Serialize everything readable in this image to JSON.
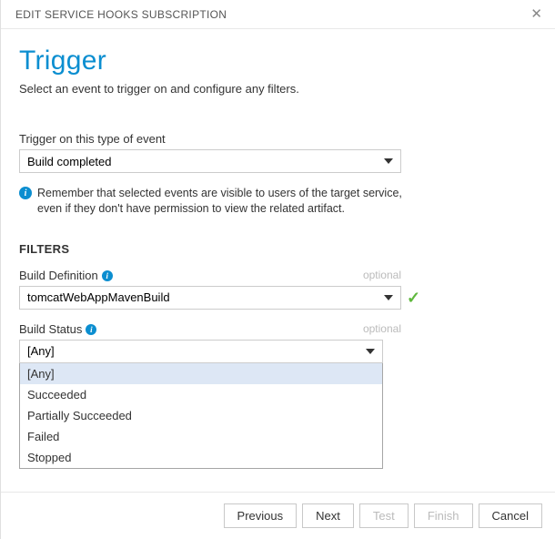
{
  "titlebar": {
    "title": "EDIT SERVICE HOOKS SUBSCRIPTION"
  },
  "header": {
    "title": "Trigger",
    "subtitle": "Select an event to trigger on and configure any filters."
  },
  "event": {
    "label": "Trigger on this type of event",
    "value": "Build completed",
    "info": "Remember that selected events are visible to users of the target service, even if they don't have permission to view the related artifact."
  },
  "filters": {
    "header": "FILTERS",
    "optional": "optional",
    "definition": {
      "label": "Build Definition",
      "value": "tomcatWebAppMavenBuild"
    },
    "status": {
      "label": "Build Status",
      "value": "[Any]",
      "options": [
        "[Any]",
        "Succeeded",
        "Partially Succeeded",
        "Failed",
        "Stopped"
      ]
    }
  },
  "footer": {
    "previous": "Previous",
    "next": "Next",
    "test": "Test",
    "finish": "Finish",
    "cancel": "Cancel"
  }
}
